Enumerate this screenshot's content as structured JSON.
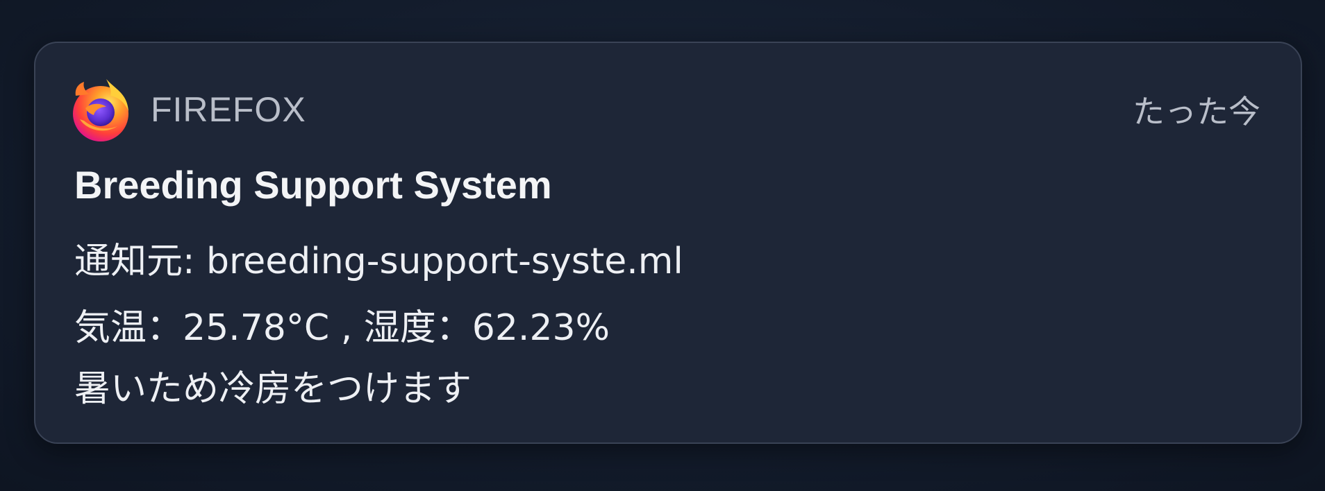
{
  "notification": {
    "app_name": "FIREFOX",
    "timestamp": "たった今",
    "app_icon": "firefox-logo-icon",
    "title": "Breeding Support System",
    "source": "通知元: breeding-support-syste.ml",
    "reading": "気温：25.78°C , 湿度：62.23%",
    "action": "暑いため冷房をつけます"
  },
  "colors": {
    "background": "#131c2c",
    "card": "#1e2637",
    "card_border": "#3a4356",
    "primary_text": "#f3f4f6",
    "secondary_text": "#b9bec9"
  }
}
